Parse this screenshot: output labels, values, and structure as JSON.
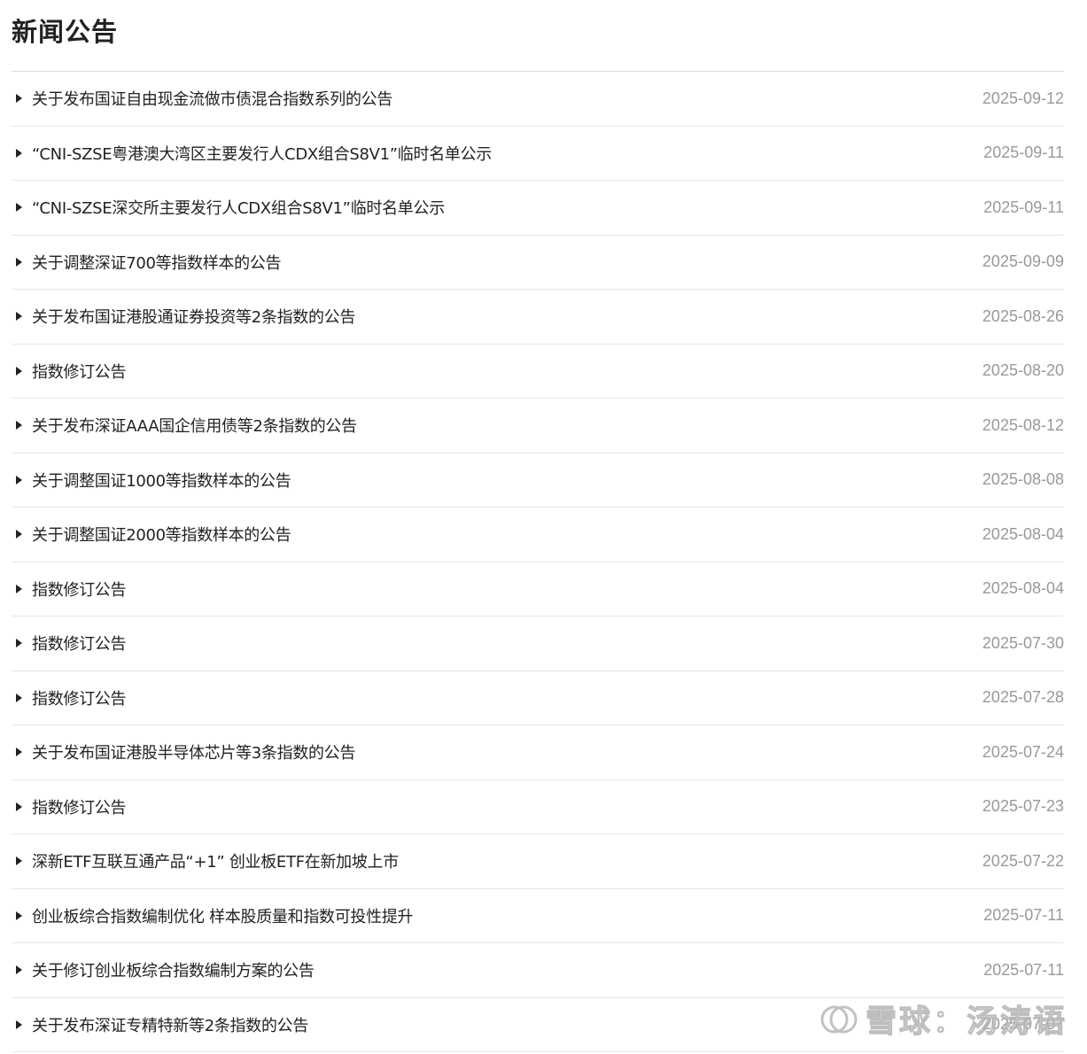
{
  "header": {
    "title": "新闻公告"
  },
  "news": [
    {
      "title": "关于发布国证自由现金流做市债混合指数系列的公告",
      "date": "2025-09-12"
    },
    {
      "title": "“CNI-SZSE粤港澳大湾区主要发行人CDX组合S8V1”临时名单公示",
      "date": "2025-09-11"
    },
    {
      "title": "“CNI-SZSE深交所主要发行人CDX组合S8V1”临时名单公示",
      "date": "2025-09-11"
    },
    {
      "title": "关于调整深证700等指数样本的公告",
      "date": "2025-09-09"
    },
    {
      "title": "关于发布国证港股通证券投资等2条指数的公告",
      "date": "2025-08-26"
    },
    {
      "title": "指数修订公告",
      "date": "2025-08-20"
    },
    {
      "title": "关于发布深证AAA国企信用债等2条指数的公告",
      "date": "2025-08-12"
    },
    {
      "title": "关于调整国证1000等指数样本的公告",
      "date": "2025-08-08"
    },
    {
      "title": "关于调整国证2000等指数样本的公告",
      "date": "2025-08-04"
    },
    {
      "title": "指数修订公告",
      "date": "2025-08-04"
    },
    {
      "title": "指数修订公告",
      "date": "2025-07-30"
    },
    {
      "title": "指数修订公告",
      "date": "2025-07-28"
    },
    {
      "title": "关于发布国证港股半导体芯片等3条指数的公告",
      "date": "2025-07-24"
    },
    {
      "title": "指数修订公告",
      "date": "2025-07-23"
    },
    {
      "title": "深新ETF互联互通产品“+1” 创业板ETF在新加坡上市",
      "date": "2025-07-22"
    },
    {
      "title": "创业板综合指数编制优化 样本股质量和指数可投性提升",
      "date": "2025-07-11"
    },
    {
      "title": "关于修订创业板综合指数编制方案的公告",
      "date": "2025-07-11"
    },
    {
      "title": "关于发布深证专精特新等2条指数的公告",
      "date": "2025-07-07"
    }
  ],
  "watermark": {
    "text": "雪球：汤涛语"
  }
}
